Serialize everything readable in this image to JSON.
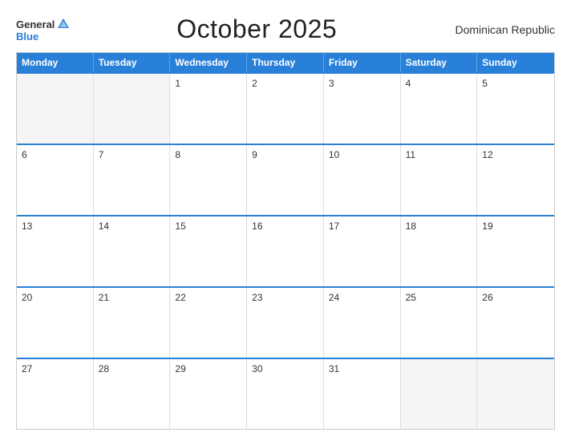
{
  "header": {
    "logo_general": "General",
    "logo_blue": "Blue",
    "title": "October 2025",
    "country": "Dominican Republic"
  },
  "calendar": {
    "days": [
      "Monday",
      "Tuesday",
      "Wednesday",
      "Thursday",
      "Friday",
      "Saturday",
      "Sunday"
    ],
    "weeks": [
      [
        {
          "num": "",
          "empty": true
        },
        {
          "num": "",
          "empty": true
        },
        {
          "num": "1",
          "empty": false
        },
        {
          "num": "2",
          "empty": false
        },
        {
          "num": "3",
          "empty": false
        },
        {
          "num": "4",
          "empty": false
        },
        {
          "num": "5",
          "empty": false
        }
      ],
      [
        {
          "num": "6",
          "empty": false
        },
        {
          "num": "7",
          "empty": false
        },
        {
          "num": "8",
          "empty": false
        },
        {
          "num": "9",
          "empty": false
        },
        {
          "num": "10",
          "empty": false
        },
        {
          "num": "11",
          "empty": false
        },
        {
          "num": "12",
          "empty": false
        }
      ],
      [
        {
          "num": "13",
          "empty": false
        },
        {
          "num": "14",
          "empty": false
        },
        {
          "num": "15",
          "empty": false
        },
        {
          "num": "16",
          "empty": false
        },
        {
          "num": "17",
          "empty": false
        },
        {
          "num": "18",
          "empty": false
        },
        {
          "num": "19",
          "empty": false
        }
      ],
      [
        {
          "num": "20",
          "empty": false
        },
        {
          "num": "21",
          "empty": false
        },
        {
          "num": "22",
          "empty": false
        },
        {
          "num": "23",
          "empty": false
        },
        {
          "num": "24",
          "empty": false
        },
        {
          "num": "25",
          "empty": false
        },
        {
          "num": "26",
          "empty": false
        }
      ],
      [
        {
          "num": "27",
          "empty": false
        },
        {
          "num": "28",
          "empty": false
        },
        {
          "num": "29",
          "empty": false
        },
        {
          "num": "30",
          "empty": false
        },
        {
          "num": "31",
          "empty": false
        },
        {
          "num": "",
          "empty": true
        },
        {
          "num": "",
          "empty": true
        }
      ]
    ]
  }
}
